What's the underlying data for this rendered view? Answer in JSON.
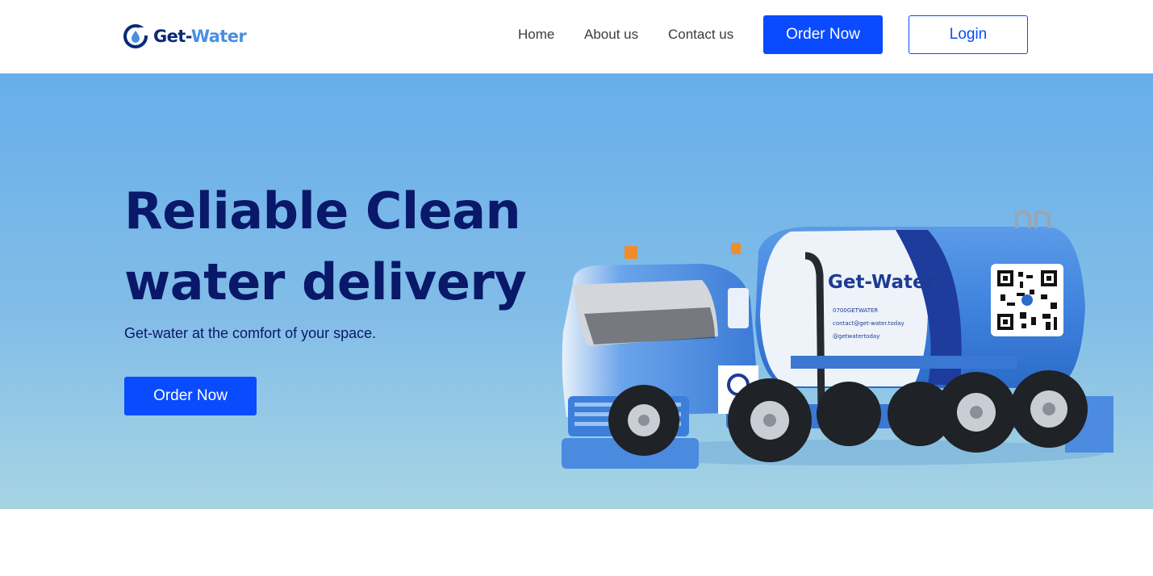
{
  "brand": {
    "name_part1": "Get-",
    "name_part2": "Water",
    "logo_icon": "water-drop-g-logo"
  },
  "nav": {
    "links": [
      {
        "label": "Home"
      },
      {
        "label": "About us"
      },
      {
        "label": "Contact us"
      }
    ],
    "order_button": "Order Now",
    "login_button": "Login"
  },
  "hero": {
    "title_line1": "Reliable Clean",
    "title_line2": "water delivery",
    "subtitle": "Get-water at the comfort of your space.",
    "cta_button": "Order Now",
    "image_alt": "Get-Water delivery tanker truck"
  },
  "truck_decal": {
    "brand": "Get-Water",
    "phone": "0700GETWATER",
    "email": "contact@get-water.today",
    "social": "@getwatertoday"
  },
  "colors": {
    "primary_button": "#0a4bff",
    "heading": "#0a1869",
    "hero_top": "#67aeea",
    "hero_bottom": "#a6d4e3",
    "logo_dark": "#0a2a78",
    "logo_light": "#4a90e2"
  }
}
